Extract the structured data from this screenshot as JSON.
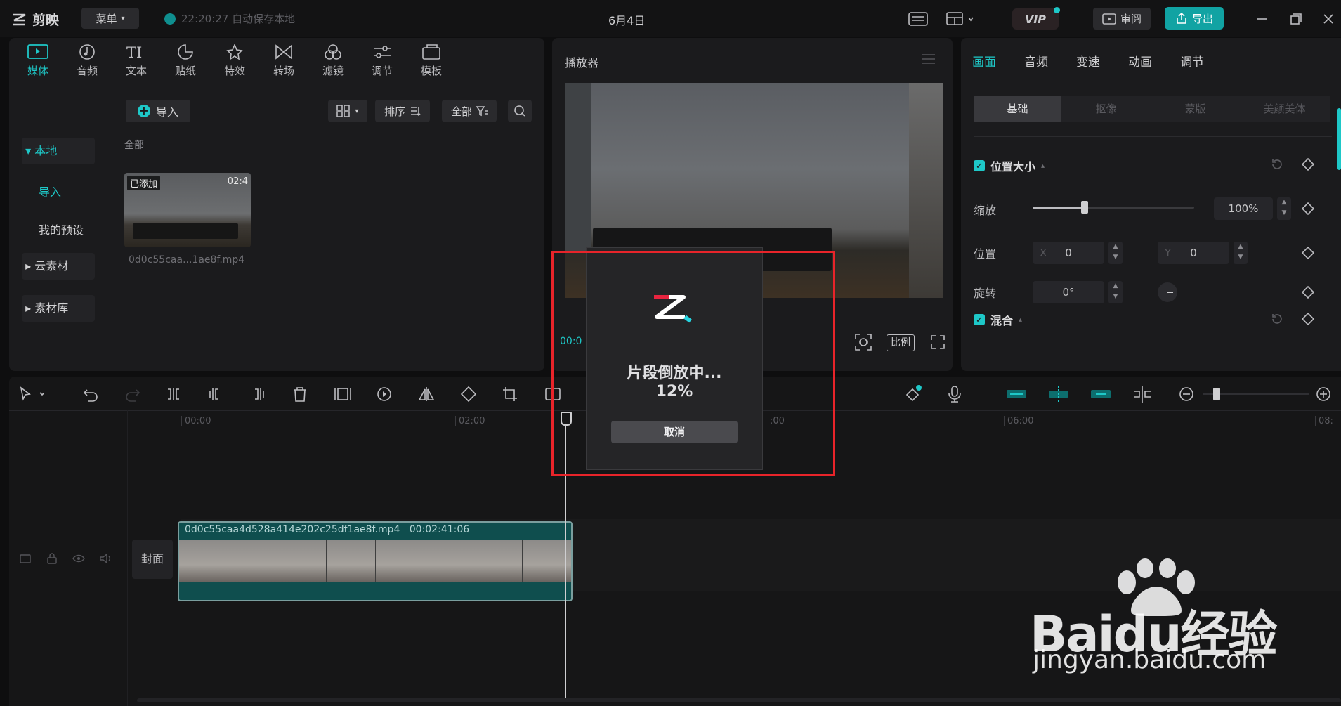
{
  "app": {
    "logo_text": "剪映",
    "menu_label": "菜单",
    "autosave": "22:20:27 自动保存本地",
    "project_title": "6月4日",
    "vip": "VIP",
    "review": "审阅",
    "export": "导出"
  },
  "media_tabs": [
    {
      "label": "媒体",
      "icon": "media-icon",
      "active": true
    },
    {
      "label": "音频",
      "icon": "audio-icon"
    },
    {
      "label": "文本",
      "icon": "text-icon"
    },
    {
      "label": "贴纸",
      "icon": "sticker-icon"
    },
    {
      "label": "特效",
      "icon": "effects-icon"
    },
    {
      "label": "转场",
      "icon": "transition-icon"
    },
    {
      "label": "滤镜",
      "icon": "filter-icon"
    },
    {
      "label": "调节",
      "icon": "adjust-icon"
    },
    {
      "label": "模板",
      "icon": "template-icon"
    }
  ],
  "sidebar": {
    "items": [
      "本地",
      "导入",
      "我的预设",
      "云素材",
      "素材库"
    ]
  },
  "media_panel": {
    "import_label": "导入",
    "sort_label": "排序",
    "filter_label": "全部",
    "section_label": "全部",
    "clip": {
      "badge": "已添加",
      "duration": "02:4",
      "filename": "0d0c55caa...1ae8f.mp4"
    }
  },
  "player": {
    "title": "播放器",
    "timecode": "00:0",
    "ratio_label": "比例"
  },
  "inspector": {
    "tabs": [
      "画面",
      "音频",
      "变速",
      "动画",
      "调节"
    ],
    "subtabs": [
      "基础",
      "抠像",
      "蒙版",
      "美颜美体"
    ],
    "sections": {
      "position_size": "位置大小",
      "blend": "混合"
    },
    "scale_label": "缩放",
    "scale_value": "100%",
    "scale_fraction": 0.32,
    "position_label": "位置",
    "x_label": "X",
    "x_value": "0",
    "y_label": "Y",
    "y_value": "0",
    "rotation_label": "旋转",
    "rotation_value": "0°"
  },
  "timeline": {
    "ruler": [
      "00:00",
      "02:00",
      ":00",
      "06:00",
      "08:"
    ],
    "cover_label": "封面",
    "clip_name": "0d0c55caa4d528a414e202c25df1ae8f.mp4",
    "clip_duration": "00:02:41:06"
  },
  "dialog": {
    "title": "片段倒放中...",
    "progress": "12%",
    "progress_value": 0.12,
    "cancel": "取消"
  },
  "watermark": {
    "brand": "Baidu经验",
    "url": "jingyan.baidu.com"
  },
  "colors": {
    "accent": "#1ec8c8",
    "highlight": "#e8242a",
    "export_bg": "#11a3a3"
  }
}
